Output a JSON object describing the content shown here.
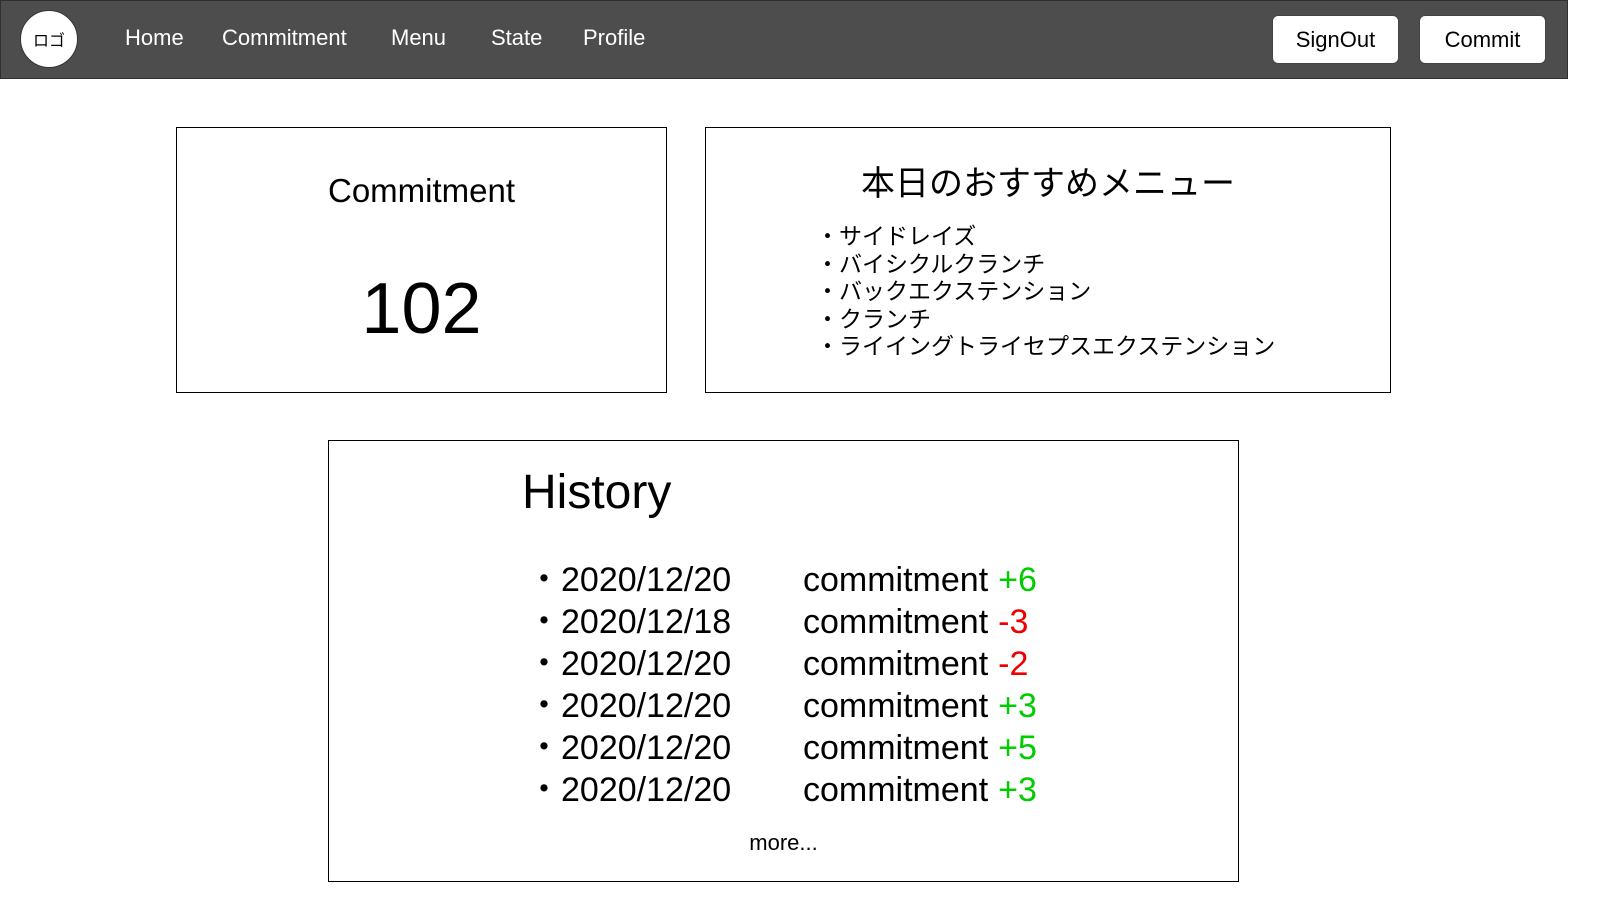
{
  "header": {
    "logo_text": "ロゴ",
    "nav": [
      {
        "label": "Home"
      },
      {
        "label": "Commitment"
      },
      {
        "label": "Menu"
      },
      {
        "label": "State"
      },
      {
        "label": "Profile"
      }
    ],
    "signout_label": "SignOut",
    "commit_label": "Commit"
  },
  "commitment_card": {
    "title": "Commitment",
    "value": "102"
  },
  "menu_card": {
    "title": "本日のおすすめメニュー",
    "items": [
      "・サイドレイズ",
      "・バイシクルクランチ",
      "・バックエクステンション",
      "・クランチ",
      "・ライイングトライセプスエクステンション"
    ]
  },
  "history": {
    "title": "History",
    "rows": [
      {
        "date": "・2020/12/20",
        "label": "commitment",
        "delta": "+6",
        "color": "#00cc00"
      },
      {
        "date": "・2020/12/18",
        "label": "commitment",
        "delta": "-3",
        "color": "#ee0000"
      },
      {
        "date": "・2020/12/20",
        "label": "commitment",
        "delta": "-2",
        "color": "#ee0000"
      },
      {
        "date": "・2020/12/20",
        "label": "commitment",
        "delta": "+3",
        "color": "#00cc00"
      },
      {
        "date": "・2020/12/20",
        "label": "commitment",
        "delta": "+5",
        "color": "#00cc00"
      },
      {
        "date": "・2020/12/20",
        "label": "commitment",
        "delta": "+3",
        "color": "#00cc00"
      }
    ],
    "more_label": "more..."
  },
  "colors": {
    "navbar_bg": "#4d4d4d",
    "positive": "#00cc00",
    "negative": "#ee0000"
  }
}
